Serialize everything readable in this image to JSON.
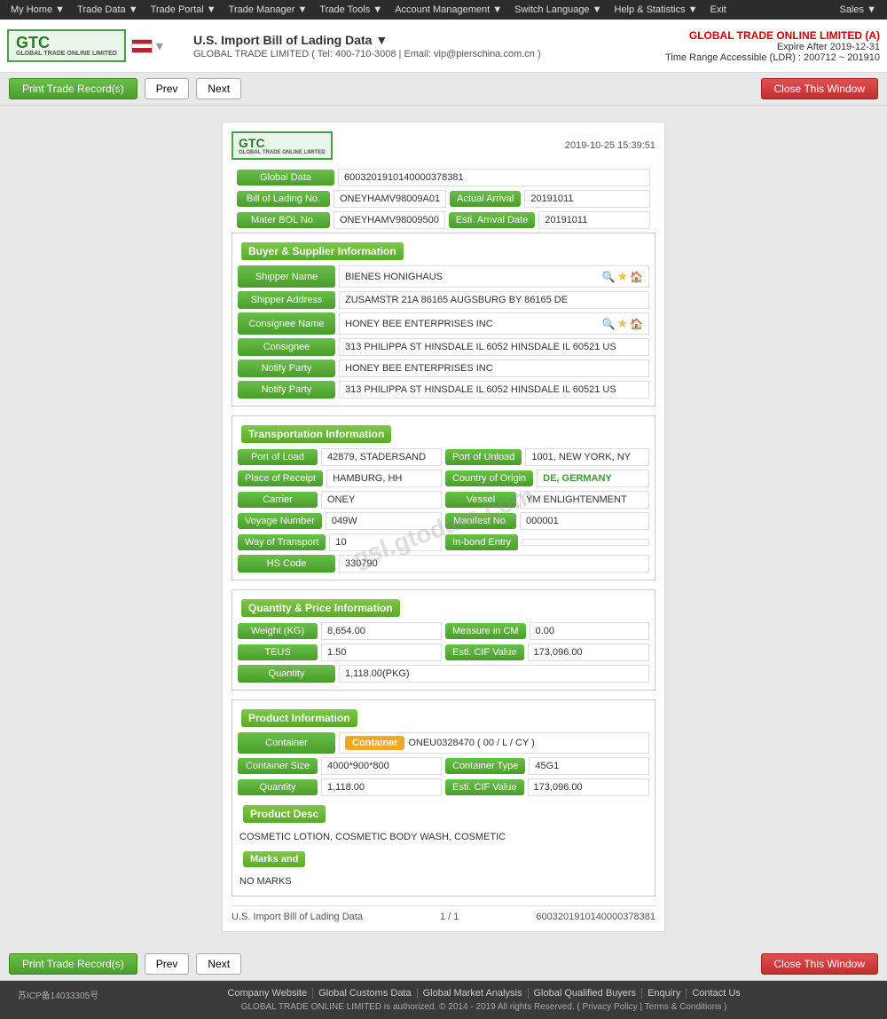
{
  "topnav": {
    "items": [
      {
        "label": "My Home ▼"
      },
      {
        "label": "Trade Data ▼"
      },
      {
        "label": "Trade Portal ▼"
      },
      {
        "label": "Trade Manager ▼"
      },
      {
        "label": "Trade Tools ▼"
      },
      {
        "label": "Account Management ▼"
      },
      {
        "label": "Switch Language ▼"
      },
      {
        "label": "Help & Statistics ▼"
      },
      {
        "label": "Exit"
      }
    ],
    "sales": "Sales ▼"
  },
  "header": {
    "company": "GLOBAL TRADE ONLINE LIMITED (A)",
    "expire": "Expire After 2019-12-31",
    "timeRange": "Time Range Accessible (LDR) : 200712 ~ 201910",
    "dataTitle": "U.S. Import Bill of Lading Data ▼",
    "phone": "GLOBAL TRADE LIMITED ( Tel: 400-710-3008 | Email: vip@pierschina.com.cn )"
  },
  "toolbar": {
    "print": "Print Trade Record(s)",
    "prev": "Prev",
    "next": "Next",
    "close": "Close This Window"
  },
  "content": {
    "timestamp": "2019-10-25 15:39:51",
    "globalData": "6003201910140000378381",
    "bolNo": "ONEYHAMV98009A01",
    "actualArrival": "20191011",
    "masterBolNo": "ONEYHAMV98009500",
    "estiArrival": "20191011",
    "sections": {
      "buyerSupplier": {
        "title": "Buyer & Supplier Information",
        "shipperName": "BIENES HONIGHAUS",
        "shipperAddress": "ZUSAMSTR 21A 86165 AUGSBURG BY 86165 DE",
        "consigneeName": "HONEY BEE ENTERPRISES INC",
        "consignee": "313 PHILIPPA ST HINSDALE IL 6052 HINSDALE IL 60521 US",
        "notifyParty": "HONEY BEE ENTERPRISES INC",
        "notifyPartyAddr": "313 PHILIPPA ST HINSDALE IL 6052 HINSDALE IL 60521 US"
      },
      "transportation": {
        "title": "Transportation Information",
        "portOfLoad": "42879, STADERSAND",
        "portOfUnload": "1001, NEW YORK, NY",
        "placeOfReceipt": "HAMBURG, HH",
        "countryOfOrigin": "DE, GERMANY",
        "carrier": "ONEY",
        "vessel": "YM ENLIGHTENMENT",
        "voyageNumber": "049W",
        "manifestNo": "000001",
        "wayOfTransport": "10",
        "inBondEntry": "",
        "hsCode": "330790"
      },
      "quantity": {
        "title": "Quantity & Price Information",
        "weightKG": "8,654.00",
        "measureInCM": "0.00",
        "teus": "1.50",
        "estiCIFValue": "173,096.00",
        "quantity": "1,118.00(PKG)"
      },
      "product": {
        "title": "Product Information",
        "container": "ONEU0328470 ( 00 / L / CY )",
        "containerSize": "4000*900*800",
        "containerType": "45G1",
        "quantity": "1,118.00",
        "estiCIFValue": "173,096.00",
        "productDesc": "COSMETIC LOTION, COSMETIC BODY WASH, COSMETIC",
        "marks": "NO MARKS"
      }
    },
    "footerLeft": "U.S. Import Bill of Lading Data",
    "footerMid": "1 / 1",
    "footerRight": "6003201910140000378381"
  },
  "labels": {
    "globalData": "Global Data",
    "bolNo": "Bill of Lading No.",
    "actualArrival": "Actual Arrival",
    "masterBolNo": "Mater BOL No.",
    "estiArrival": "Esti. Arrival Date",
    "shipperName": "Shipper Name",
    "shipperAddress": "Shipper Address",
    "consigneeName": "Consignee Name",
    "consignee": "Consignee",
    "notifyParty": "Notify Party",
    "portOfLoad": "Port of Load",
    "portOfUnload": "Port of Unload",
    "placeOfReceipt": "Place of Receipt",
    "countryOfOrigin": "Country of Origin",
    "carrier": "Carrier",
    "vessel": "Vessel",
    "voyageNumber": "Voyage Number",
    "manifestNo": "Manifest No.",
    "wayOfTransport": "Way of Transport",
    "inBondEntry": "In-bond Entry",
    "hsCode": "HS Code",
    "weightKG": "Weight (KG)",
    "measureInCM": "Measure in CM",
    "teus": "TEUS",
    "estiCIFValue": "Esti. CIF Value",
    "quantity": "Quantity",
    "container": "Container",
    "containerSize": "Container Size",
    "containerType": "Container Type",
    "productDesc": "Product Desc",
    "marksAnd": "Marks and"
  },
  "footer": {
    "icp": "苏ICP备14033305号",
    "links": [
      "Company Website",
      "Global Customs Data",
      "Global Market Analysis",
      "Global Qualified Buyers",
      "Enquiry",
      "Contact Us"
    ],
    "copyright": "GLOBAL TRADE ONLINE LIMITED is authorized. © 2014 - 2019 All rights Reserved.  ( Privacy Policy | Terms & Conditions )"
  }
}
